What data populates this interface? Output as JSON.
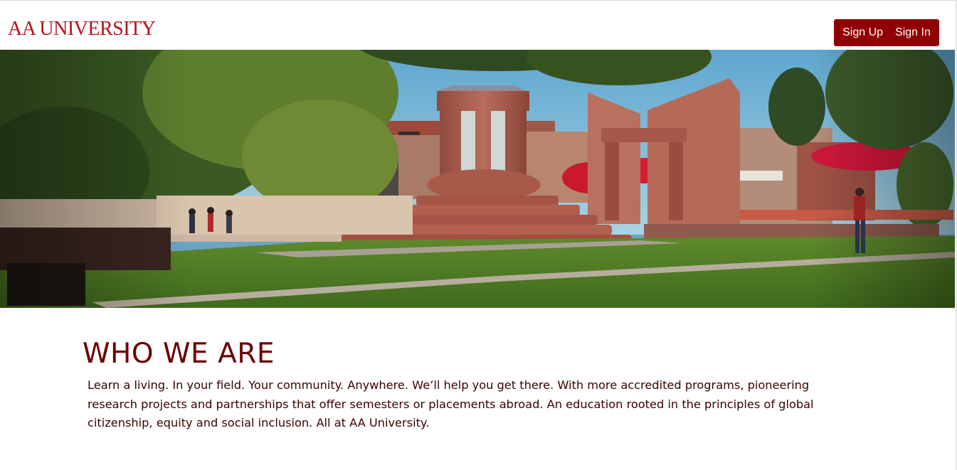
{
  "header": {
    "brand": "AA UNIVERSITY",
    "sign_up_label": "Sign Up",
    "sign_in_label": "Sign In"
  },
  "hero": {
    "image": "campus-plaza-photo"
  },
  "about": {
    "title": "WHO WE ARE",
    "text": "Learn a living. In your field. Your community. Anywhere. We’ll help you get there. With more accredited programs, pioneering research projects and partnerships that offer semesters or placements abroad. An education rooted in the principles of global citizenship, equity and social inclusion. All at AA University."
  },
  "colors": {
    "brand": "#b4121a",
    "button_bg": "#900000",
    "heading": "#6b0000",
    "body_text": "#3a0000"
  }
}
